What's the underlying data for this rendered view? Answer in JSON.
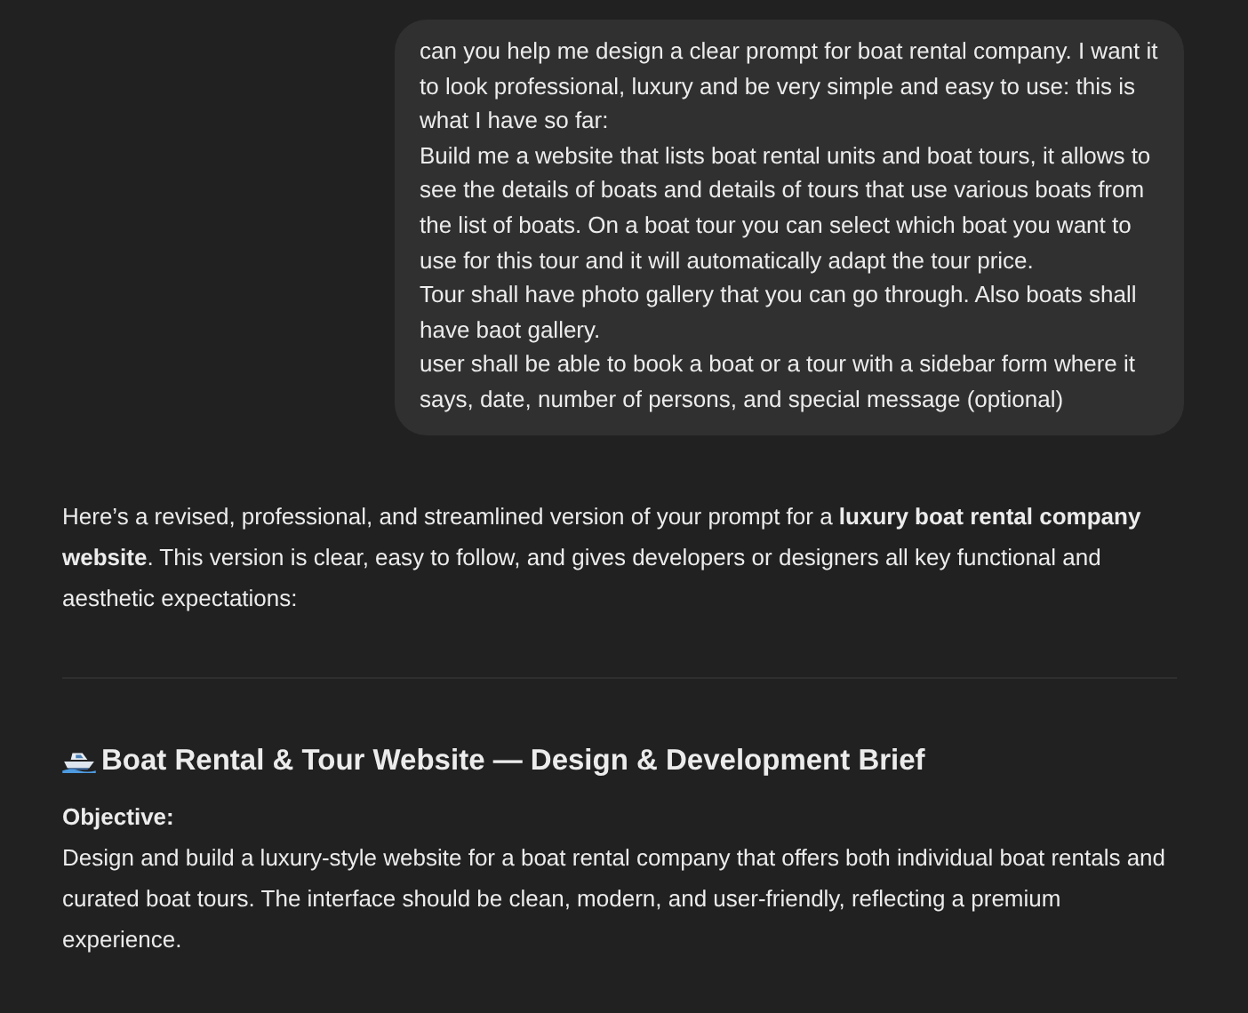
{
  "user_message": {
    "paragraphs": [
      "can you help me design a clear prompt for boat rental company. I want it to look professional, luxury and be very simple and easy to use: this is what I have so far:",
      "Build me a website that lists boat rental units and boat tours, it allows to see the details of boats and details of tours that use various boats from the list of boats. On a boat tour you can select which boat you want to use for this tour and it will automatically adapt the tour price.",
      "Tour shall have photo gallery that you can go through. Also boats shall have baot gallery.",
      "user shall be able to book a boat or a tour with a sidebar form where it says, date, number of persons, and special message (optional)"
    ]
  },
  "response": {
    "intro": "Here’s a revised, professional, and streamlined version of your prompt for a **luxury boat rental company website**. This version is clear, easy to follow, and gives developers or designers all key functional and aesthetic expectations:",
    "heading": "Boat Rental & Tour Website — Design & Development Brief",
    "section_label": "Objective:",
    "section_text": "Design and build a luxury-style website for a boat rental company that offers both individual boat rentals and curated boat tours. The interface should be clean, modern, and user-friendly, reflecting a premium experience."
  }
}
